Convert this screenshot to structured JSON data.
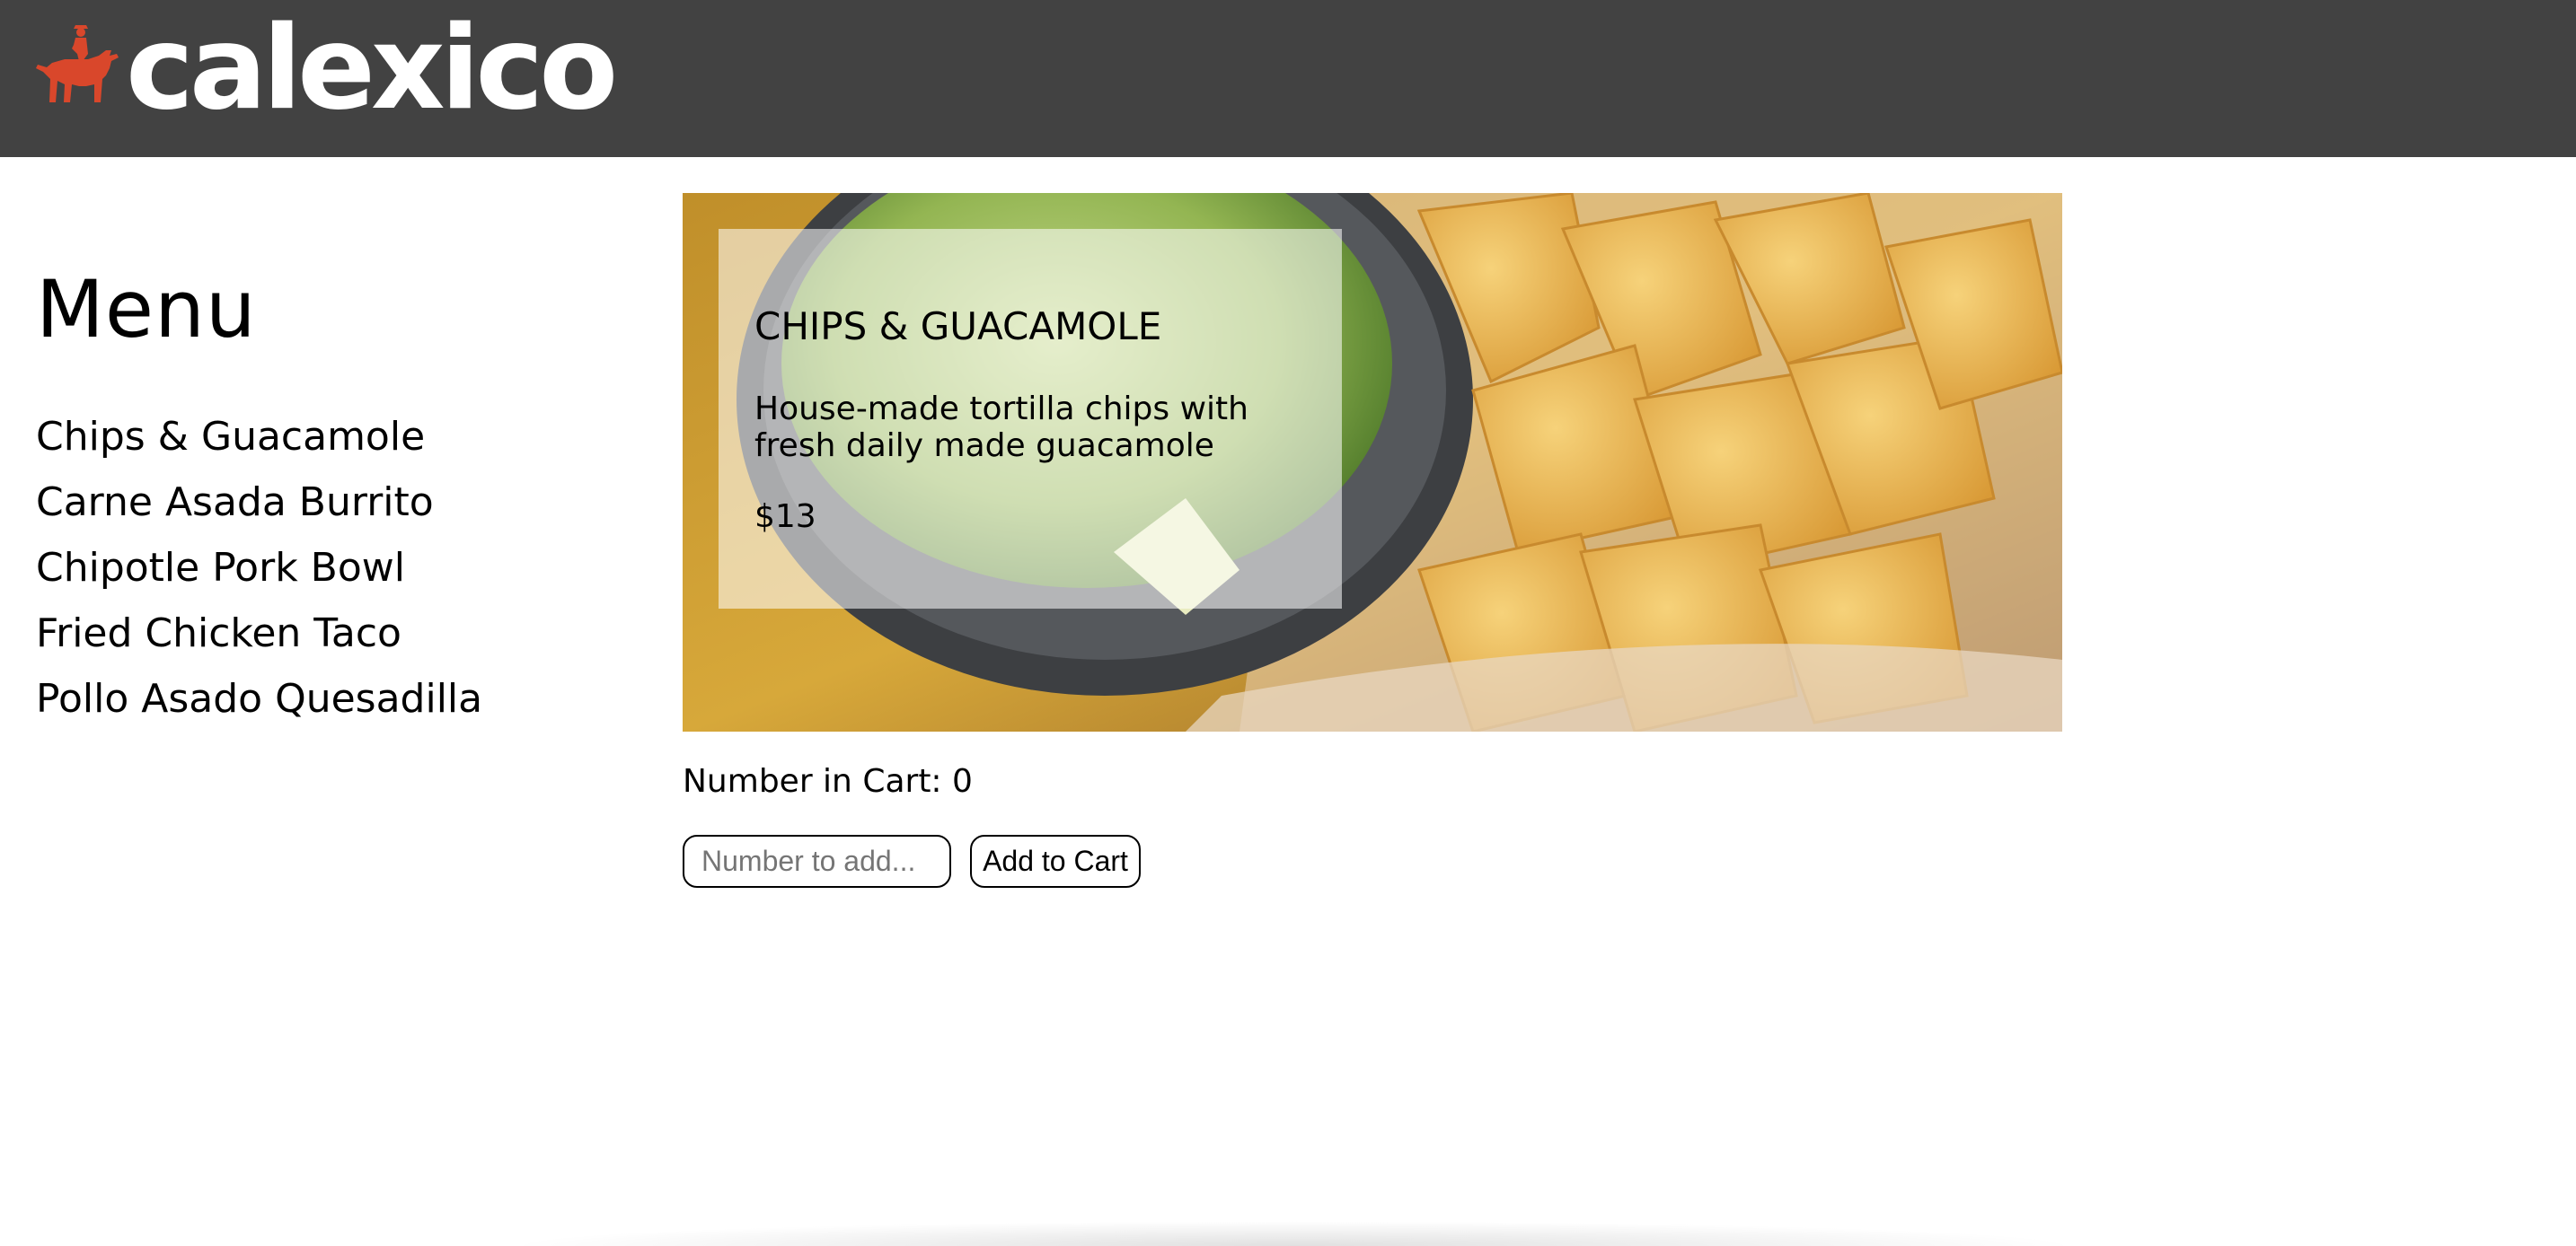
{
  "header": {
    "logo_text": "calexico",
    "logo_icon": "bull-rider-icon",
    "background_color": "#424242",
    "accent_color": "#d9472b"
  },
  "sidebar": {
    "title": "Menu",
    "items": [
      {
        "label": "Chips & Guacamole"
      },
      {
        "label": "Carne Asada Burrito"
      },
      {
        "label": "Chipotle Pork Bowl"
      },
      {
        "label": "Fried Chicken Taco"
      },
      {
        "label": "Pollo Asado Quesadilla"
      }
    ]
  },
  "item": {
    "name": "CHIPS & GUACAMOLE",
    "description": "House-made tortilla chips with fresh daily made guacamole",
    "price": "$13",
    "image": "chips-and-guacamole-photo"
  },
  "cart": {
    "count_text": "Number in Cart: 0",
    "input_placeholder": "Number to add...",
    "input_value": "",
    "add_button_label": "Add to Cart"
  }
}
